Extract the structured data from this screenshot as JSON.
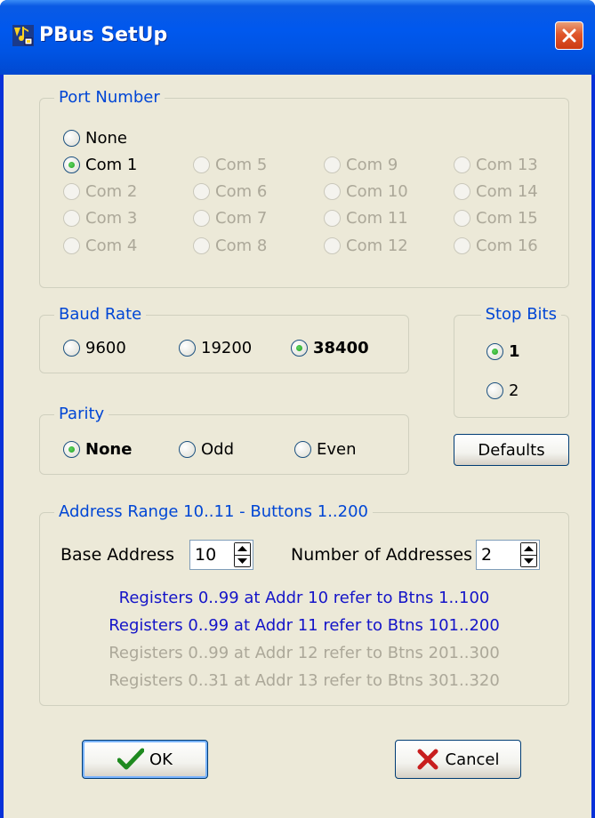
{
  "window": {
    "title": "PBus SetUp"
  },
  "port": {
    "legend": "Port Number",
    "none_label": "None",
    "ports": [
      {
        "label": "Com 1",
        "checked": true,
        "enabled": true
      },
      {
        "label": "Com 2",
        "checked": false,
        "enabled": false
      },
      {
        "label": "Com 3",
        "checked": false,
        "enabled": false
      },
      {
        "label": "Com 4",
        "checked": false,
        "enabled": false
      },
      {
        "label": "Com 5",
        "checked": false,
        "enabled": false
      },
      {
        "label": "Com 6",
        "checked": false,
        "enabled": false
      },
      {
        "label": "Com 7",
        "checked": false,
        "enabled": false
      },
      {
        "label": "Com 8",
        "checked": false,
        "enabled": false
      },
      {
        "label": "Com 9",
        "checked": false,
        "enabled": false
      },
      {
        "label": "Com 10",
        "checked": false,
        "enabled": false
      },
      {
        "label": "Com 11",
        "checked": false,
        "enabled": false
      },
      {
        "label": "Com 12",
        "checked": false,
        "enabled": false
      },
      {
        "label": "Com 13",
        "checked": false,
        "enabled": false
      },
      {
        "label": "Com 14",
        "checked": false,
        "enabled": false
      },
      {
        "label": "Com 15",
        "checked": false,
        "enabled": false
      },
      {
        "label": "Com 16",
        "checked": false,
        "enabled": false
      }
    ]
  },
  "baud": {
    "legend": "Baud Rate",
    "options": [
      {
        "label": "9600",
        "checked": false
      },
      {
        "label": "19200",
        "checked": false
      },
      {
        "label": "38400",
        "checked": true
      }
    ]
  },
  "stop_bits": {
    "legend": "Stop Bits",
    "options": [
      {
        "label": "1",
        "checked": true
      },
      {
        "label": "2",
        "checked": false
      }
    ]
  },
  "parity": {
    "legend": "Parity",
    "options": [
      {
        "label": "None",
        "checked": true
      },
      {
        "label": "Odd",
        "checked": false
      },
      {
        "label": "Even",
        "checked": false
      }
    ]
  },
  "defaults_button": "Defaults",
  "address": {
    "legend": "Address Range 10..11 - Buttons 1..200",
    "base_label": "Base Address",
    "base_value": "10",
    "count_label": "Number of Addresses",
    "count_value": "2",
    "lines": [
      {
        "text": "Registers 0..99 at Addr 10 refer to Btns 1..100",
        "active": true
      },
      {
        "text": "Registers 0..99 at Addr 11 refer to Btns 101..200",
        "active": true
      },
      {
        "text": "Registers 0..99 at Addr 12 refer to Btns 201..300",
        "active": false
      },
      {
        "text": "Registers 0..31 at Addr 13 refer to Btns 301..320",
        "active": false
      }
    ]
  },
  "buttons": {
    "ok": "OK",
    "cancel": "Cancel"
  },
  "colors": {
    "title_bar": "#0054e3",
    "dialog_bg": "#ece9d8",
    "group_label": "#0046d5",
    "active_info": "#1414c8",
    "disabled_text": "#aca899",
    "ok_check": "#1f8a1f",
    "cancel_x": "#c81e1e"
  },
  "icons": {
    "app": "pbus-app-icon",
    "close": "close-x-icon",
    "ok": "checkmark-icon",
    "cancel": "x-mark-icon"
  }
}
